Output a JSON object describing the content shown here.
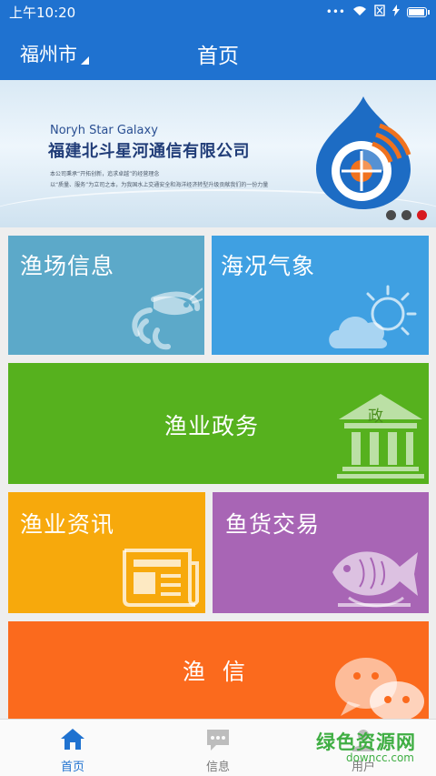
{
  "status_bar": {
    "time": "上午10:20",
    "signal": "•••"
  },
  "app_bar": {
    "city": "福州市",
    "title": "首页"
  },
  "banner": {
    "company_en": "Noryh Star Galaxy",
    "company_cn": "福建北斗星河通信有限公司",
    "desc_line1": "本公司秉承“开拓创新，追求卓越”的经营理念",
    "desc_line2": "以“质量、服务”为立司之本，为我国水上交通安全和海洋经济转型升级贡献我们的一份力量",
    "slide_count": 3,
    "active_slide": 3
  },
  "tiles": {
    "fishing_ground": {
      "label": "渔场信息",
      "icon": "shrimp-icon"
    },
    "sea_weather": {
      "label": "海况气象",
      "icon": "weather-cloud-sun-icon"
    },
    "fishery_affairs": {
      "label": "渔业政务",
      "icon": "government-building-icon",
      "badge": "政"
    },
    "fishery_news": {
      "label": "渔业资讯",
      "icon": "newspaper-icon"
    },
    "fish_trade": {
      "label": "鱼货交易",
      "icon": "fish-plate-icon"
    },
    "fishing_message": {
      "label": "渔  信",
      "icon": "chat-bubbles-icon"
    }
  },
  "bottom_nav": {
    "items": [
      {
        "label": "首页",
        "icon": "home-icon",
        "active": true
      },
      {
        "label": "信息",
        "icon": "message-icon",
        "active": false
      },
      {
        "label": "用户",
        "icon": "user-icon",
        "active": false
      }
    ]
  },
  "watermark": {
    "title": "绿色资源网",
    "url": "downcc.com"
  },
  "colors": {
    "primary": "#1f72d0",
    "fishing_ground": "#5ca9c9",
    "sea_weather": "#3fa0e2",
    "fishery_affairs": "#56b11e",
    "fishery_news": "#f7a90c",
    "fish_trade": "#a865b5",
    "fishing_message": "#fb6a1d"
  }
}
